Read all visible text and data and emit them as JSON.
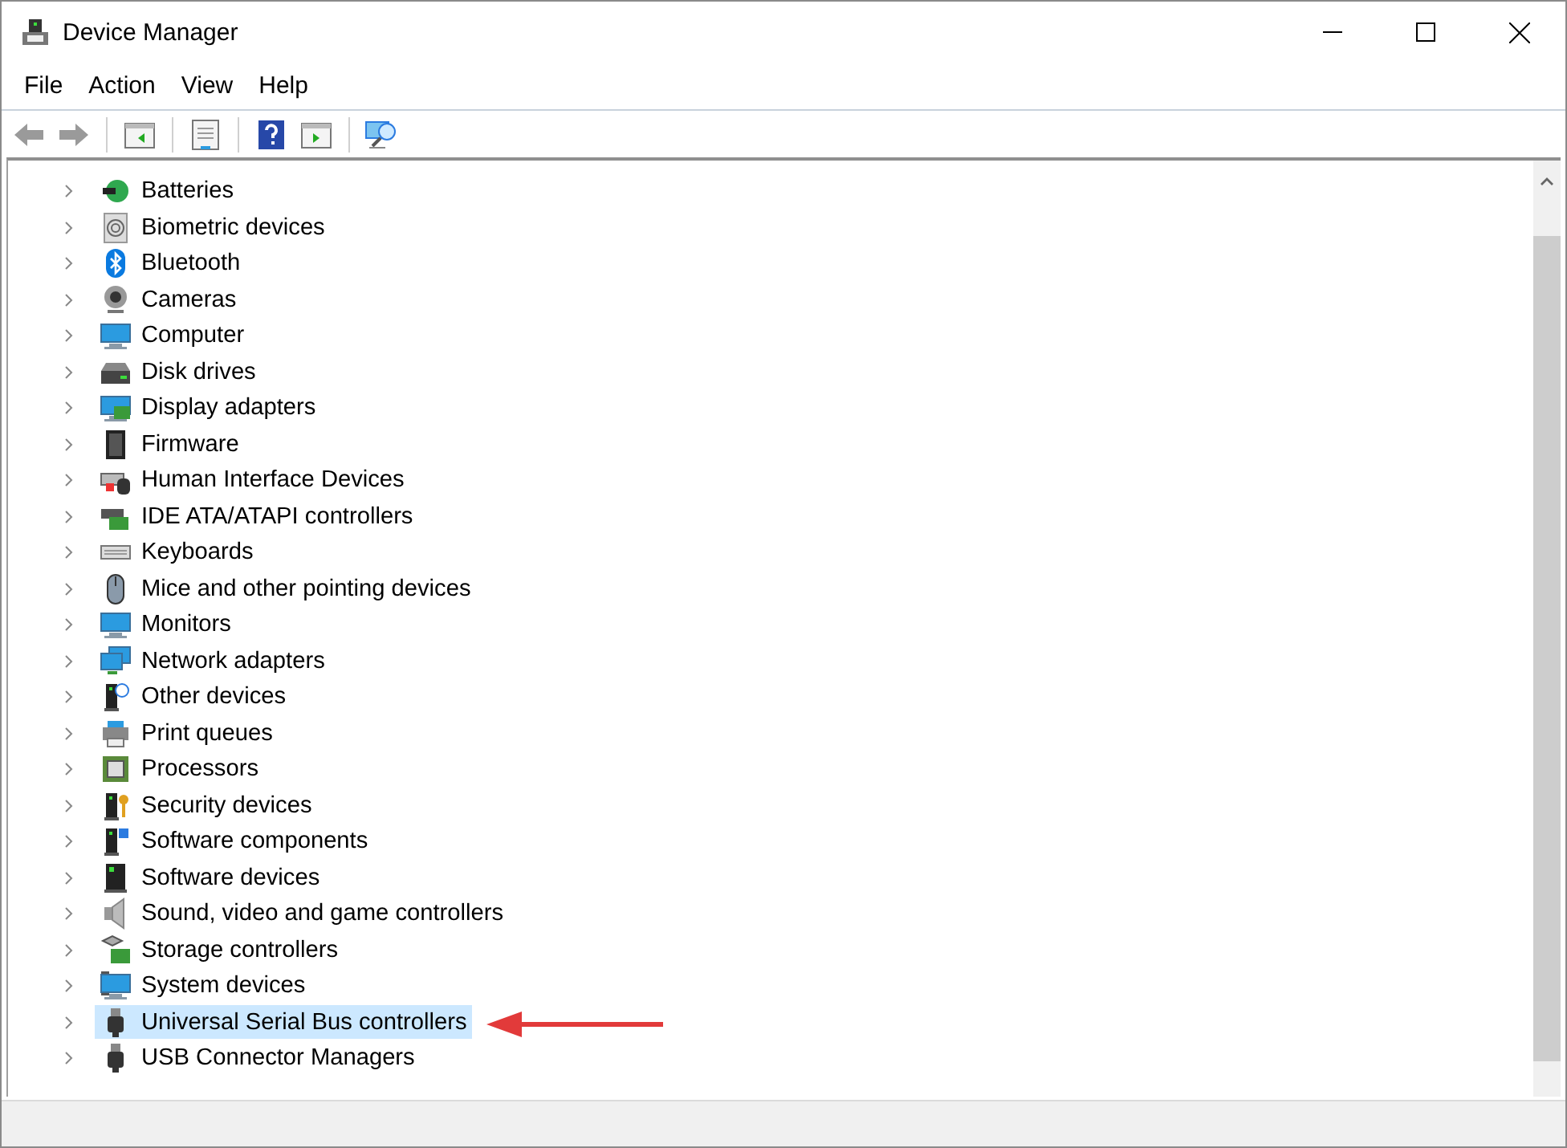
{
  "window": {
    "title": "Device Manager"
  },
  "menu": [
    "File",
    "Action",
    "View",
    "Help"
  ],
  "tree": [
    {
      "label": "Batteries",
      "expanded": false,
      "selected": false
    },
    {
      "label": "Biometric devices",
      "expanded": false,
      "selected": false
    },
    {
      "label": "Bluetooth",
      "expanded": false,
      "selected": false
    },
    {
      "label": "Cameras",
      "expanded": false,
      "selected": false
    },
    {
      "label": "Computer",
      "expanded": false,
      "selected": false
    },
    {
      "label": "Disk drives",
      "expanded": false,
      "selected": false
    },
    {
      "label": "Display adapters",
      "expanded": false,
      "selected": false
    },
    {
      "label": "Firmware",
      "expanded": false,
      "selected": false
    },
    {
      "label": "Human Interface Devices",
      "expanded": false,
      "selected": false
    },
    {
      "label": "IDE ATA/ATAPI controllers",
      "expanded": false,
      "selected": false
    },
    {
      "label": "Keyboards",
      "expanded": false,
      "selected": false
    },
    {
      "label": "Mice and other pointing devices",
      "expanded": false,
      "selected": false
    },
    {
      "label": "Monitors",
      "expanded": false,
      "selected": false
    },
    {
      "label": "Network adapters",
      "expanded": false,
      "selected": false
    },
    {
      "label": "Other devices",
      "expanded": false,
      "selected": false
    },
    {
      "label": "Print queues",
      "expanded": false,
      "selected": false
    },
    {
      "label": "Processors",
      "expanded": false,
      "selected": false
    },
    {
      "label": "Security devices",
      "expanded": false,
      "selected": false
    },
    {
      "label": "Software components",
      "expanded": false,
      "selected": false
    },
    {
      "label": "Software devices",
      "expanded": false,
      "selected": false
    },
    {
      "label": "Sound, video and game controllers",
      "expanded": false,
      "selected": false
    },
    {
      "label": "Storage controllers",
      "expanded": false,
      "selected": false
    },
    {
      "label": "System devices",
      "expanded": false,
      "selected": false
    },
    {
      "label": "Universal Serial Bus controllers",
      "expanded": false,
      "selected": true
    },
    {
      "label": "USB Connector Managers",
      "expanded": false,
      "selected": false
    }
  ]
}
